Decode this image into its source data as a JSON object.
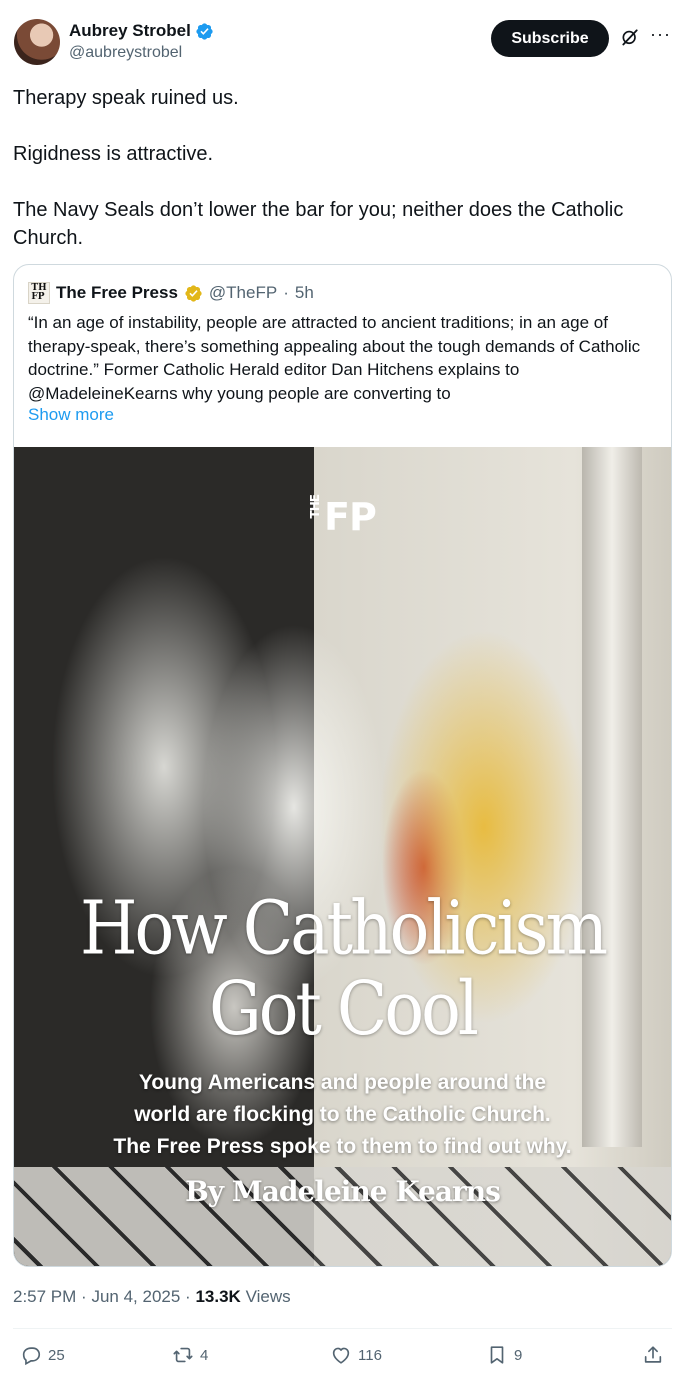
{
  "author": {
    "name": "Aubrey Strobel",
    "handle": "@aubreystrobel"
  },
  "header": {
    "subscribe_label": "Subscribe",
    "grok_icon": "grok-icon",
    "more_icon": "more-icon"
  },
  "tweet": {
    "lines": [
      "Therapy speak ruined us.",
      "Rigidness is attractive.",
      "The Navy Seals don’t lower the bar for you; neither does the Catholic Church."
    ]
  },
  "quote": {
    "name": "The Free Press",
    "handle": "@TheFP",
    "separator": "·",
    "time": "5h",
    "text": "“In an age of instability, people are attracted to ancient traditions; in an age of therapy-speak, there’s something appealing about the tough demands of Catholic doctrine.” Former Catholic Herald editor Dan Hitchens explains to @MadeleineKearns why young people are converting to",
    "show_more": "Show more",
    "media": {
      "logo": "FP",
      "logo_prefix": "THE",
      "headline_line1": "How Catholicism",
      "headline_line2": "Got Cool",
      "sub_line1": "Young Americans and people around the",
      "sub_line2": "world are flocking to the Catholic Church.",
      "sub_line3": "The Free Press spoke to them to find out why.",
      "byline": "By Madeleine Kearns"
    }
  },
  "meta": {
    "time": "2:57 PM",
    "sep1": "·",
    "date": "Jun 4, 2025",
    "sep2": "·",
    "views_count": "13.3K",
    "views_label": "Views"
  },
  "actions": {
    "replies": "25",
    "reposts": "4",
    "likes": "116",
    "bookmarks": "9"
  },
  "colors": {
    "accent": "#1d9bf0",
    "verified_blue": "#1d9bf0",
    "verified_gold": "#e2b719",
    "text": "#0f1419",
    "muted": "#536471"
  }
}
